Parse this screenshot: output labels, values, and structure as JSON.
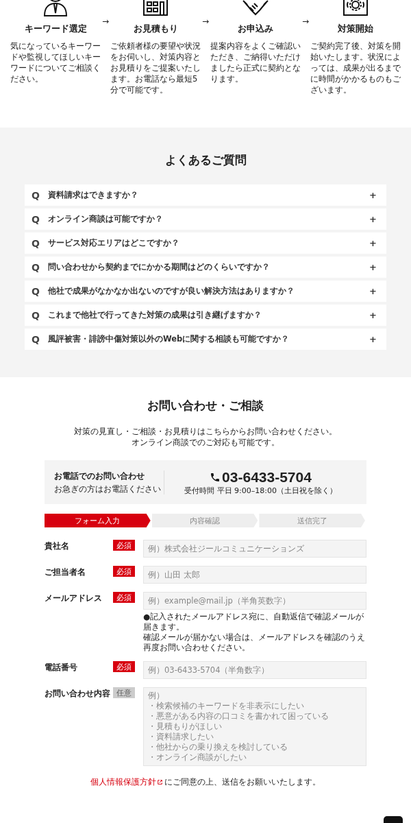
{
  "flow": {
    "steps": [
      {
        "title": "キーワード選定",
        "text": "気になっているキーワードや監視してほしいキーワードについてご相談ください。"
      },
      {
        "title": "お見積もり",
        "text": "ご依頼者様の要望や状況をお伺いし、対策内容とお見積りをご提案いたします。お電話なら最短5分で可能です。"
      },
      {
        "title": "お申込み",
        "text": "提案内容をよくご確認いただき、ご納得いただけましたら正式に契約となります。"
      },
      {
        "title": "対策開始",
        "text": "ご契約完了後、対策を開始いたします。状況によっては、成果が出るまでに時間がかかるものもございます。"
      }
    ],
    "arrow": "→"
  },
  "faq": {
    "title": "よくあるご質問",
    "items": [
      {
        "mark": "Q",
        "question": "資料請求はできますか？",
        "toggle": "+"
      },
      {
        "mark": "Q",
        "question": "オンライン商談は可能ですか？",
        "toggle": "+"
      },
      {
        "mark": "Q",
        "question": "サービス対応エリアはどこですか？",
        "toggle": "+"
      },
      {
        "mark": "Q",
        "question": "問い合わせから契約までにかかる期間はどのくらいですか？",
        "toggle": "+"
      },
      {
        "mark": "Q",
        "question": "他社で成果がなかなか出ないのですが良い解決方法はありますか？",
        "toggle": "+"
      },
      {
        "mark": "Q",
        "question": "これまで他社で行ってきた対策の成果は引き継げますか？",
        "toggle": "+"
      },
      {
        "mark": "Q",
        "question": "風評被害・誹謗中傷対策以外のWebに関する相談も可能ですか？",
        "toggle": "+"
      }
    ]
  },
  "contact": {
    "title": "お問い合わせ・ご相談",
    "intro": [
      "対策の見直し・ご相談・お見積りはこちらからお問い合わせください。",
      "オンライン商談でのご対応も可能です。"
    ],
    "phone_box": {
      "heading": "お電話でのお問い合わせ",
      "sub": "お急ぎの方はお電話ください",
      "number": "03-6433-5704",
      "hours": "受付時間 平日 9:00–18:00（土日祝を除く）"
    },
    "progress": [
      {
        "label": "フォーム入力",
        "selected": true
      },
      {
        "label": "内容確認",
        "selected": false
      },
      {
        "label": "送信完了",
        "selected": false
      }
    ],
    "fields": [
      {
        "kind": "input",
        "label": "貴社名",
        "required": true,
        "badge": "必須",
        "placeholder": "例）株式会社ジールコミュニケーションズ"
      },
      {
        "kind": "input",
        "label": "ご担当者名",
        "required": true,
        "badge": "必須",
        "placeholder": "例）山田 太郎"
      },
      {
        "kind": "input",
        "label": "メールアドレス",
        "required": true,
        "badge": "必須",
        "placeholder": "例）example@mail.jp（半角英数字）",
        "notes": [
          "●記入されたメールアドレス宛に、自動返信で確認メールが届きます。",
          "確認メールが届かない場合は、メールアドレスを確認のうえ再度お問い合わせください。"
        ]
      },
      {
        "kind": "input",
        "label": "電話番号",
        "required": true,
        "badge": "必須",
        "placeholder": "例）03-6433-5704（半角数字）"
      },
      {
        "kind": "textarea",
        "label": "お問い合わせ内容",
        "required": false,
        "badge": "任意",
        "placeholder_lines": [
          "例）",
          "・検索候補のキーワードを非表示にしたい",
          "・悪意がある内容の口コミを書かれて困っている",
          "・見積もりがほしい",
          "・資料請求したい",
          "・他社からの乗り換えを検討している",
          "・オンライン商談がしたい"
        ]
      }
    ],
    "privacy": {
      "link": "個人情報保護方針",
      "text": "にご同意の上、送信をお願いいたします。"
    }
  }
}
